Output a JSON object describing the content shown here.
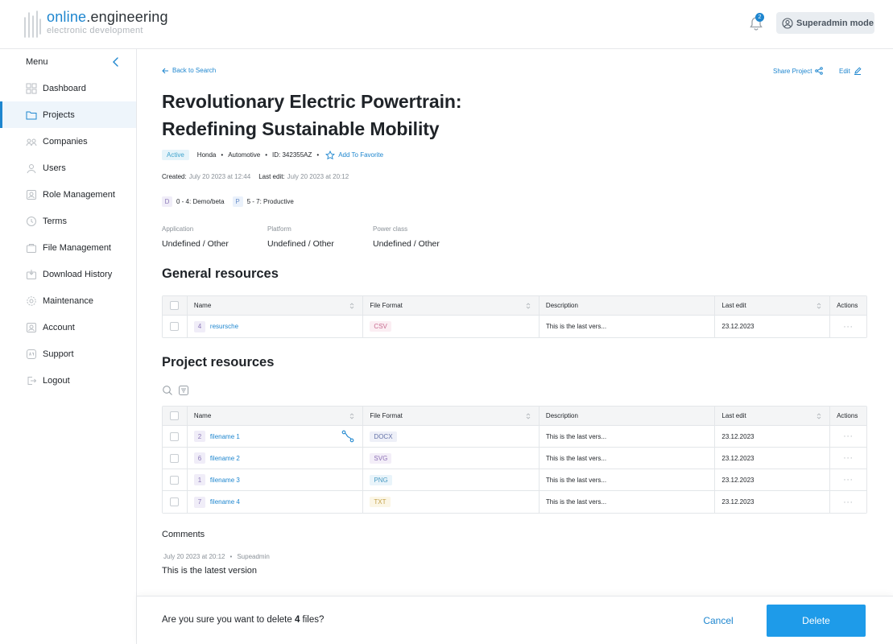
{
  "header": {
    "logo_brand": "online",
    "logo_rest": ".engineering",
    "logo_sub": "electronic development",
    "notification_count": "2",
    "mode_label": "Superadmin mode"
  },
  "sidebar": {
    "menu_label": "Menu",
    "items": [
      {
        "label": "Dashboard",
        "icon": "dashboard-icon"
      },
      {
        "label": "Projects",
        "icon": "folder-icon",
        "active": true
      },
      {
        "label": "Companies",
        "icon": "companies-icon"
      },
      {
        "label": "Users",
        "icon": "users-icon"
      },
      {
        "label": "Role Management",
        "icon": "role-icon"
      },
      {
        "label": "Terms",
        "icon": "clock-icon"
      },
      {
        "label": "File Management",
        "icon": "file-management-icon"
      },
      {
        "label": "Download History",
        "icon": "download-history-icon"
      },
      {
        "label": "Maintenance",
        "icon": "maintenance-icon"
      },
      {
        "label": "Account",
        "icon": "account-icon"
      },
      {
        "label": "Support",
        "icon": "support-icon"
      },
      {
        "label": "Logout",
        "icon": "logout-icon"
      }
    ]
  },
  "project": {
    "back_label": "Back to Search",
    "share_label": "Share Project",
    "edit_label": "Edit",
    "title": "Revolutionary Electric Powertrain: Redefining Sustainable Mobility",
    "status": "Active",
    "company": "Honda",
    "sector": "Automotive",
    "id_label": "ID: 342355AZ",
    "favorite_label": "Add To Favorite",
    "created_label": "Created:",
    "created_value": "July 20 2023 at 12:44",
    "last_edit_label": "Last edit:",
    "last_edit_value": "July 20 2023 at 20:12",
    "stages": [
      {
        "tag": "D",
        "label": "0 - 4: Demo/beta"
      },
      {
        "tag": "P",
        "label": "5 - 7: Productive"
      }
    ],
    "attributes": [
      {
        "label": "Application",
        "value": "Undefined / Other"
      },
      {
        "label": "Platform",
        "value": "Undefined / Other"
      },
      {
        "label": "Power class",
        "value": "Undefined / Other"
      }
    ]
  },
  "tables": {
    "headers": {
      "name": "Name",
      "format": "File Format",
      "description": "Description",
      "last_edit": "Last edit",
      "actions": "Actions"
    },
    "general_title": "General resources",
    "general_rows": [
      {
        "num": "4",
        "name": "resursche",
        "format": "CSV",
        "description": "This is the last vers...",
        "last_edit": "23.12.2023"
      }
    ],
    "project_title": "Project resources",
    "project_rows": [
      {
        "num": "2",
        "name": "filename 1",
        "format": "DOCX",
        "description": "This is the last vers...",
        "last_edit": "23.12.2023"
      },
      {
        "num": "6",
        "name": "filename 2",
        "format": "SVG",
        "description": "This is the last vers...",
        "last_edit": "23.12.2023"
      },
      {
        "num": "1",
        "name": "filename 3",
        "format": "PNG",
        "description": "This is the last vers...",
        "last_edit": "23.12.2023"
      },
      {
        "num": "7",
        "name": "filename 4",
        "format": "TXT",
        "description": "This is the last vers...",
        "last_edit": "23.12.2023"
      }
    ],
    "actions_glyph": "···"
  },
  "format_colors": {
    "CSV": {
      "bg": "#fbeef3",
      "fg": "#c76a8f"
    },
    "DOCX": {
      "bg": "#eef0f8",
      "fg": "#6673a8"
    },
    "SVG": {
      "bg": "#f3eef8",
      "fg": "#8c6fb5"
    },
    "PNG": {
      "bg": "#e9f4fa",
      "fg": "#4a9bc3"
    },
    "TXT": {
      "bg": "#fbf6e6",
      "fg": "#c3a24a"
    }
  },
  "comments": {
    "title": "Comments",
    "date": "July 20 2023 at 20:12",
    "author": "Supeadmin",
    "text": "This is the latest version"
  },
  "confirm": {
    "prefix": "Are you sure you want to delete ",
    "count": "4",
    "suffix": " files?",
    "cancel_label": "Cancel",
    "delete_label": "Delete"
  },
  "colors": {
    "accent": "#1e86cf",
    "delete_button": "#1e9be9",
    "active_nav_bg": "#eef5fb"
  }
}
